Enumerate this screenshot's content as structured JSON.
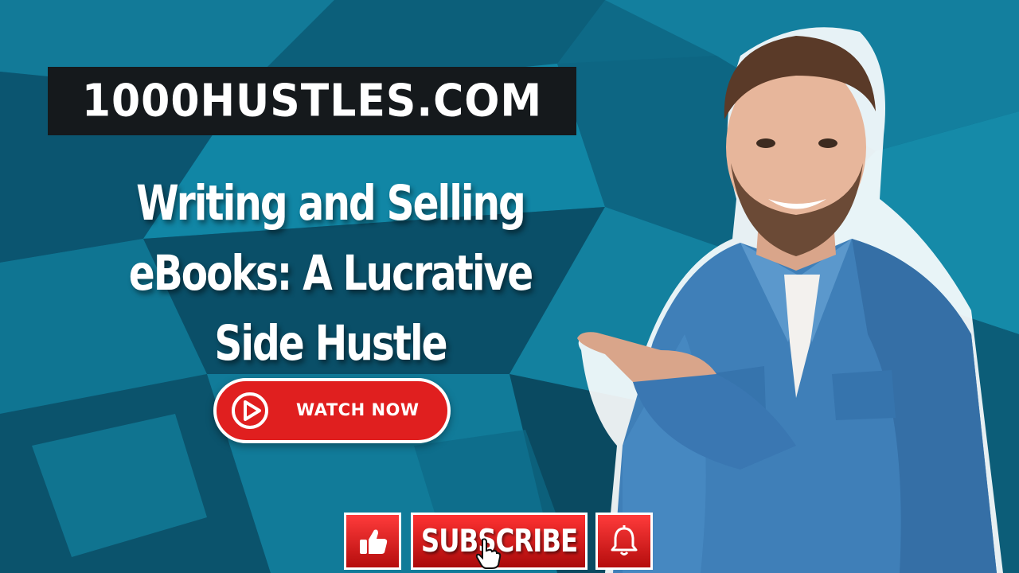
{
  "brand": {
    "text": "1000HUSTLES.COM"
  },
  "headline": {
    "lines": [
      "Writing and Selling",
      "eBooks: A Lucrative",
      "Side Hustle"
    ]
  },
  "watch_button": {
    "label": "WATCH NOW",
    "icon": "play-circle-icon"
  },
  "subscribe_bar": {
    "like_icon": "thumbs-up-icon",
    "subscribe_label": "SUBSCRIBE",
    "cursor_icon": "hand-cursor-icon",
    "bell_icon": "bell-icon"
  },
  "person": {
    "description_icon": "smiling-man-pointing"
  },
  "colors": {
    "background": "#0f6f8c",
    "accent_red": "#e01f1f",
    "brand_box": "#15191c",
    "shirt": "#3f7fb8"
  }
}
